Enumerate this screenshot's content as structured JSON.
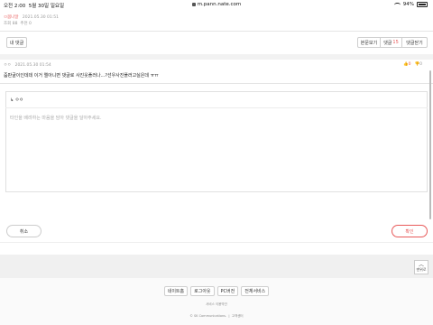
{
  "status_bar": {
    "time": "오전 2:00",
    "date": "5월 30일 일요일",
    "url": "m.pann.nate.com",
    "battery": "94%"
  },
  "post_meta": {
    "author": "ㅁ몸나알",
    "date": "2021.05.30 01:51",
    "views_label": "조회 88",
    "likes_label": "추천 0"
  },
  "buttons": {
    "my_comments": "내 댓글",
    "view_original": "본문보기",
    "comments_label": "댓글",
    "comments_count": "15",
    "close_comments": "댓글닫기"
  },
  "comment": {
    "author": "ㅇㅇ",
    "date": "2021.05.30 01:54",
    "text": "줌판굴이인데데 이거 엘아니면 댓글로 사진웃플러나...?선우사진플러고실은데 ㅠㅠ",
    "up_count": "0",
    "down_count": "0"
  },
  "reply": {
    "writer": "ㅇㅇ",
    "placeholder": "타인을 배려하는 마음을 담아 댓글을 달아주세요."
  },
  "actions": {
    "cancel": "취소",
    "confirm": "확인"
  },
  "top_button": "맨위로",
  "footer": {
    "links": [
      "네이트홈",
      "로그아웃",
      "PC버전",
      "전체서비스"
    ],
    "terms": "서비스 이용약관",
    "copyright": "© SK Communications.",
    "support": "고객센터"
  },
  "colors": {
    "accent": "#e85a5a",
    "border": "#cfcfcf"
  }
}
